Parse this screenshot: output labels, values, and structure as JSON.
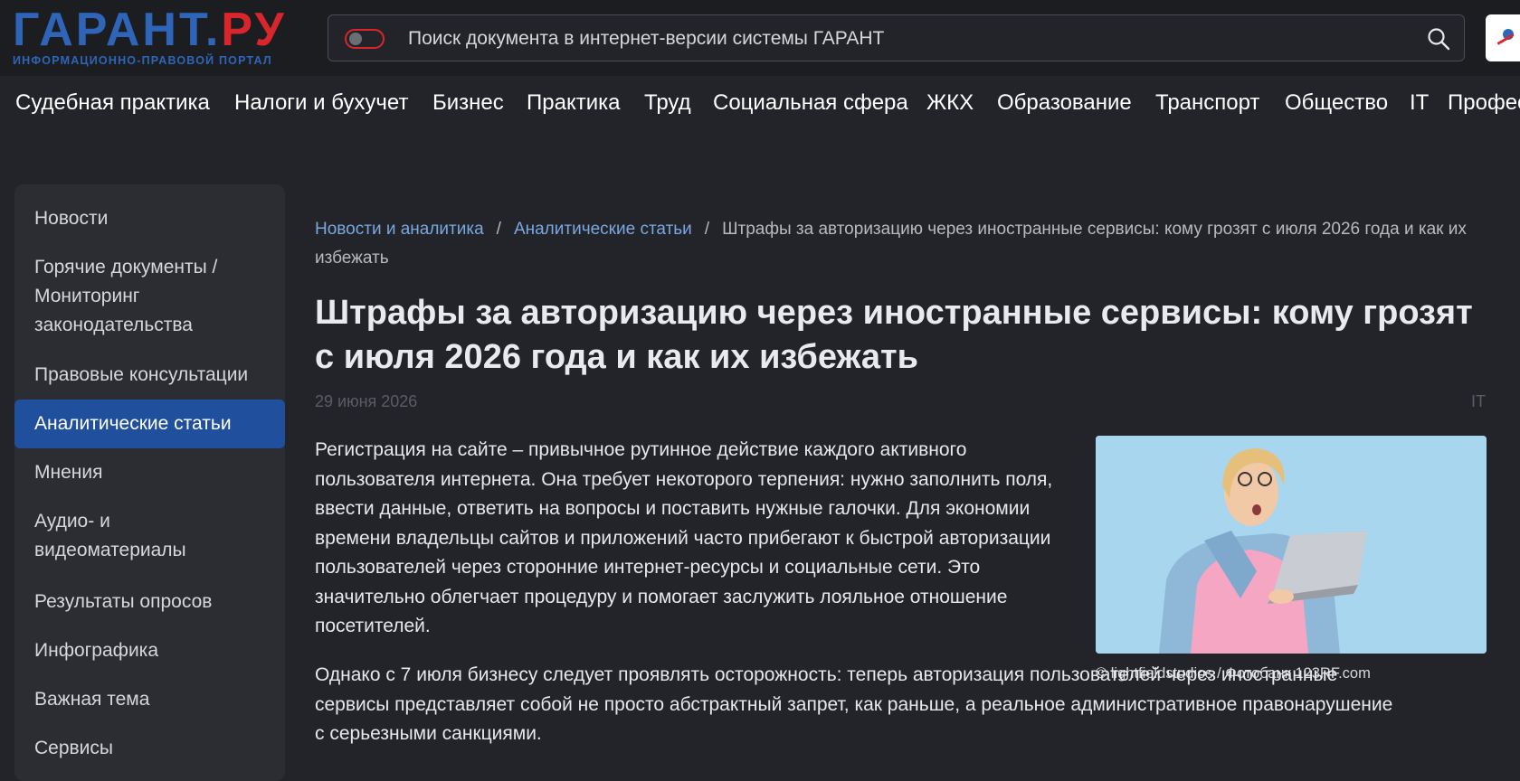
{
  "logo": {
    "part1": "ГАРАНТ",
    "part2": ".",
    "part3": "РУ",
    "subtitle": "ИНФОРМАЦИОННО-ПРАВОВОЙ ПОРТАЛ",
    "brand_blue": "#2f65b8",
    "brand_red": "#d9262c"
  },
  "search": {
    "placeholder": "Поиск документа в интернет-версии системы ГАРАНТ",
    "icon": "search-icon"
  },
  "nav": {
    "items": [
      "Судебная практика",
      "Налоги и бухучет",
      "Бизнес",
      "Практика",
      "Труд",
      "Социальная сфера",
      "ЖКХ",
      "Образование",
      "Транспорт",
      "Общество",
      "IT",
      "Профес"
    ]
  },
  "sidebar": {
    "items": [
      {
        "label": "Новости"
      },
      {
        "label": "Горячие документы / Мониторинг законодательства"
      },
      {
        "label": "Правовые консультации"
      },
      {
        "label": "Аналитические статьи",
        "active": true
      },
      {
        "label": "Мнения"
      },
      {
        "label": "Аудио- и видеоматериалы"
      },
      {
        "label": "Результаты опросов"
      },
      {
        "label": "Инфографика"
      },
      {
        "label": "Важная тема"
      },
      {
        "label": "Сервисы"
      }
    ],
    "active_color": "#1f4f9d"
  },
  "breadcrumb": {
    "link1": "Новости и аналитика",
    "link2": "Аналитические статьи",
    "separator": "/",
    "current": "Штрафы за авторизацию через иностранные сервисы: кому грозят с июля 2026 года и как их избежать"
  },
  "article": {
    "title": "Штрафы за авторизацию через иностранные сервисы: кому грозят с июля 2026 года и как их избежать",
    "date": "29 июня 2026",
    "tag": "IT",
    "paragraph1": "Регистрация на сайте – привычное рутинное действие каждого активного пользователя интернета. Она требует некоторого терпения: нужно заполнить поля, ввести данные, ответить на вопросы и поставить нужные галочки. Для экономии времени владельцы сайтов и приложений часто прибегают к быстрой авторизации пользователей через сторонние интернет-ресурсы и социальные сети. Это значительно облегчает процедуру и помогает заслужить лояльное отношение посетителей.",
    "paragraph2": "Однако с 7 июля бизнесу следует проявлять осторожность: теперь авторизация пользователей через иностранные сервисы представляет собой не просто абстрактный запрет, как раньше, а реальное административное правонарушение с серьезными санкциями.",
    "photo_caption": "© lightfieldstudios / Фотобанк 123RF.com"
  }
}
